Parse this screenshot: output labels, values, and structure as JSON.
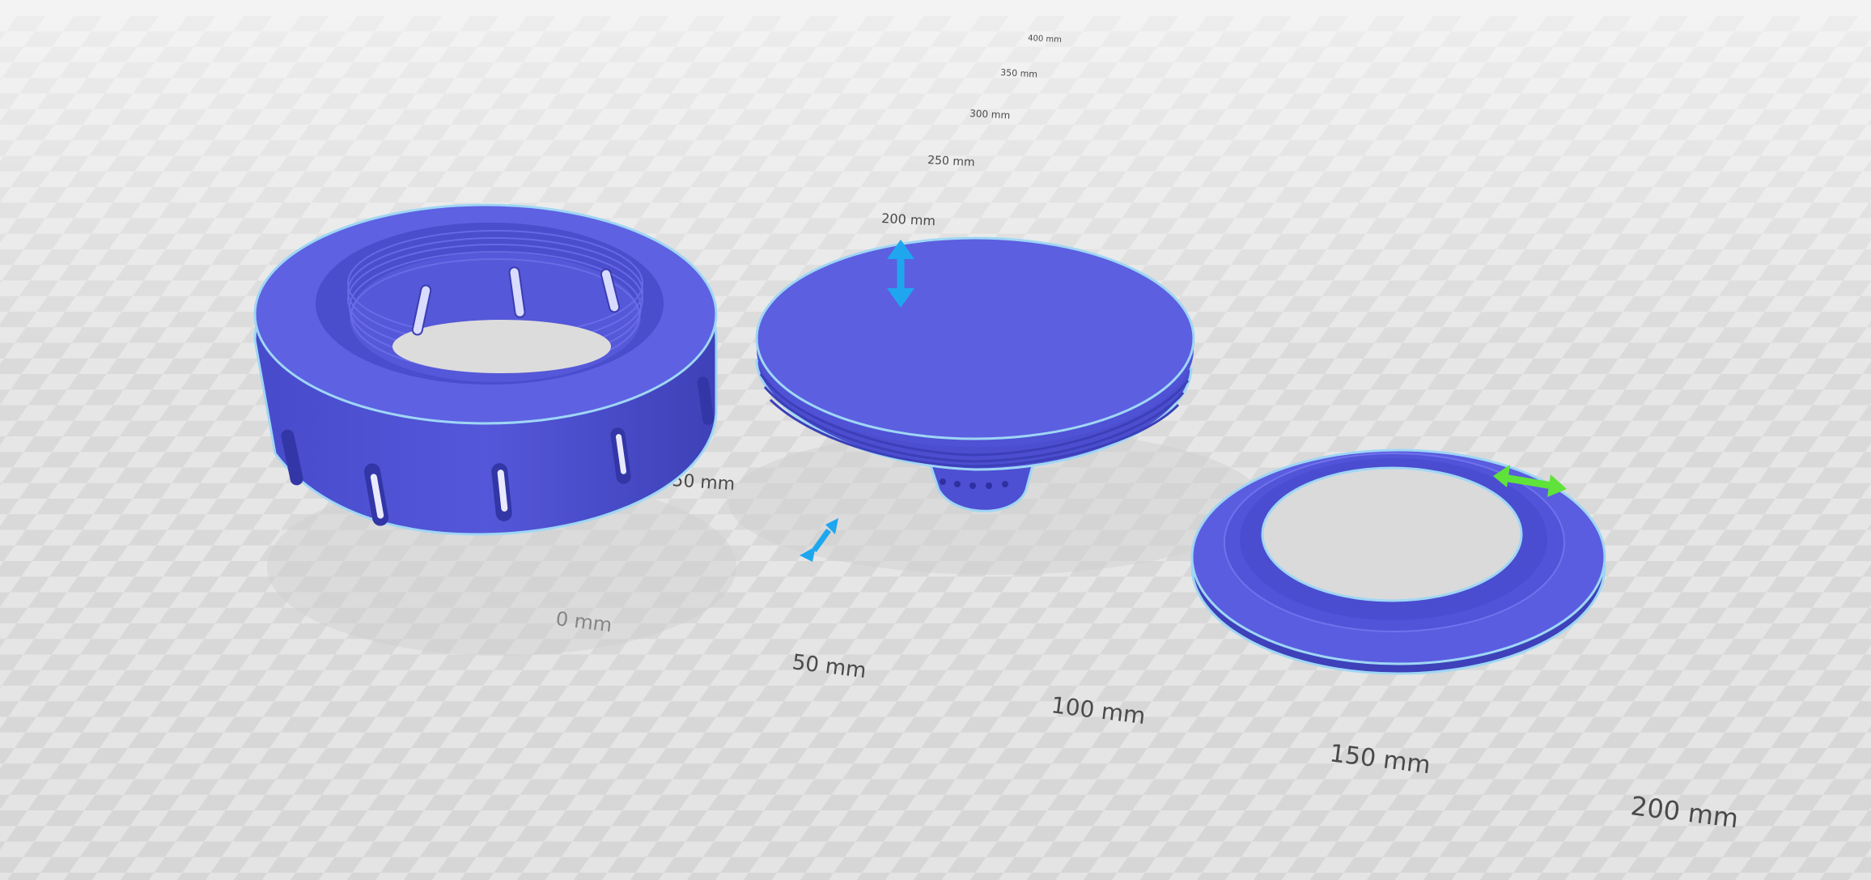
{
  "app": {
    "view_name": "3D build plate viewer"
  },
  "colors": {
    "background": "#e9e9e9",
    "model_body": "#5b5ee0",
    "model_shadow": "#3f42b8",
    "model_outline": "#9fd6f5",
    "arrow_cyan": "#1ea7ef",
    "arrow_green": "#5fe33a"
  },
  "grid_labels": {
    "x_axis": [
      "0 mm",
      "50 mm",
      "100 mm",
      "150 mm",
      "200 mm"
    ],
    "y_axis": [
      "50 mm",
      "200 mm",
      "250 mm",
      "300 mm",
      "350 mm",
      "400 mm"
    ]
  },
  "models": [
    {
      "name": "threaded-collar-ring",
      "icon": "ring-with-slots"
    },
    {
      "name": "funnel-cap",
      "icon": "disc-funnel"
    },
    {
      "name": "flat-washer-ring",
      "icon": "flat-ring"
    }
  ],
  "gizmos": [
    {
      "name": "vertical-move-arrow",
      "icon": "double-arrow-vertical",
      "color": "cyan"
    },
    {
      "name": "diagonal-move-arrow",
      "icon": "double-arrow-diagonal",
      "color": "cyan"
    },
    {
      "name": "horizontal-move-arrow",
      "icon": "double-arrow-horizontal",
      "color": "green"
    }
  ]
}
